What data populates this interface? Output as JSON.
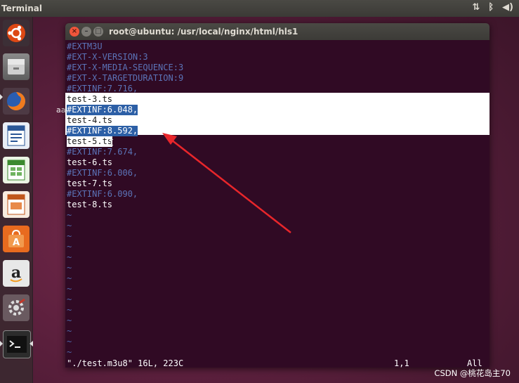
{
  "top_panel": {
    "app_title": "Terminal",
    "tray_icons": [
      "network-arrows-icon",
      "bluetooth-icon",
      "volume-icon"
    ]
  },
  "launcher": {
    "items": [
      {
        "name": "ubuntu-dash-icon"
      },
      {
        "name": "files-icon"
      },
      {
        "name": "firefox-icon"
      },
      {
        "name": "libreoffice-writer-icon"
      },
      {
        "name": "libreoffice-calc-icon"
      },
      {
        "name": "libreoffice-impress-icon"
      },
      {
        "name": "software-center-icon"
      },
      {
        "name": "amazon-icon"
      },
      {
        "name": "system-settings-icon"
      },
      {
        "name": "terminal-icon"
      }
    ]
  },
  "desktop": {
    "label": "aa"
  },
  "window": {
    "title": "root@ubuntu: /usr/local/nginx/html/hls1"
  },
  "terminal": {
    "lines": [
      "#EXTM3U",
      "#EXT-X-VERSION:3",
      "#EXT-X-MEDIA-SEQUENCE:3",
      "#EXT-X-TARGETDURATION:9",
      "#EXTINF:7.716,",
      "test-3.ts",
      "#EXTINF:6.048,",
      "test-4.ts",
      "#EXTINF:8.592,",
      "test-5.ts",
      "#EXTINF:7.674,",
      "test-6.ts",
      "#EXTINF:6.006,",
      "test-7.ts",
      "#EXTINF:6.090,",
      "test-8.ts"
    ],
    "tilde": "~",
    "status_file": "\"./test.m3u8\" 16L, 223C",
    "status_position": "1,1",
    "status_scroll": "All"
  },
  "colors": {
    "terminal_bg": "#300a24",
    "comment": "#5b73b7",
    "selection": "#2c5fa6",
    "annotation_arrow": "#e8262b"
  },
  "watermark": "CSDN @桃花岛主70"
}
